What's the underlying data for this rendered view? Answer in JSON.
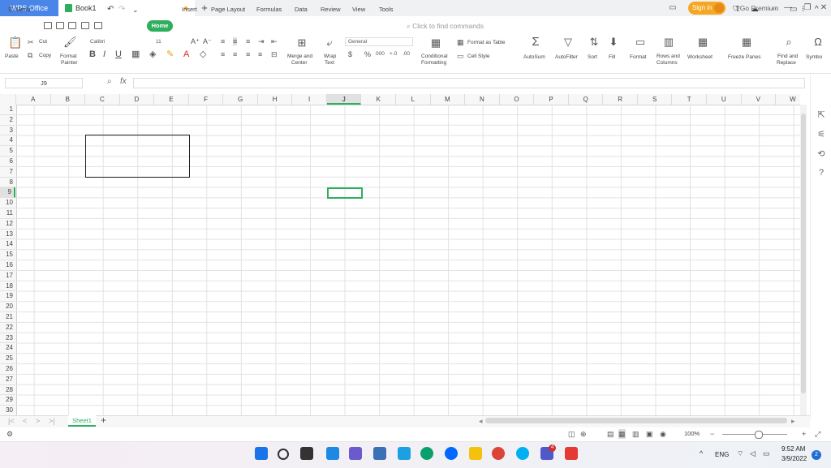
{
  "titlebar": {
    "app_tab": "WPS Office",
    "doc_tab": "Book1",
    "new_tab_icon": "plus-icon",
    "sign_in": "Sign in",
    "go_premium": "Go Premium"
  },
  "menu": {
    "menu_label": "Menu",
    "tabs": [
      "Home",
      "Insert",
      "Page Layout",
      "Formulas",
      "Data",
      "Review",
      "View",
      "Tools"
    ],
    "find_placeholder": "Click to find commands"
  },
  "ribbon": {
    "paste": "Paste",
    "cut": "Cut",
    "copy": "Copy",
    "format_painter_1": "Format",
    "format_painter_2": "Painter",
    "font_name": "Calibri",
    "font_size": "11",
    "bold": "B",
    "italic": "I",
    "underline": "U",
    "merge_1": "Merge and",
    "merge_2": "Center",
    "wrap_1": "Wrap",
    "wrap_2": "Text",
    "number_format": "General",
    "currency": "$",
    "percent": "%",
    "thousands": "000",
    "inc_decimal": "+.0",
    "dec_decimal": ".00",
    "cond_1": "Conditional",
    "cond_2": "Formatting",
    "format_as_table": "Format as Table",
    "cell_style": "Cell Style",
    "autosum": "AutoSum",
    "autofilter": "AutoFilter",
    "sort": "Sort",
    "fill": "Fill",
    "format": "Format",
    "rows_cols_1": "Rows and",
    "rows_cols_2": "Columns",
    "worksheet": "Worksheet",
    "freeze_panes": "Freeze Panes",
    "find_replace_1": "Find and",
    "find_replace_2": "Replace",
    "symbol": "Symbo"
  },
  "formula_bar": {
    "name_box": "J9",
    "fx": "fx",
    "value": ""
  },
  "grid": {
    "columns": [
      "A",
      "B",
      "C",
      "D",
      "E",
      "F",
      "G",
      "H",
      "I",
      "J",
      "K",
      "L",
      "M",
      "N",
      "O",
      "P",
      "Q",
      "R",
      "S",
      "T",
      "U",
      "V",
      "W"
    ],
    "rows": [
      "1",
      "2",
      "3",
      "4",
      "5",
      "6",
      "7",
      "8",
      "9",
      "10",
      "11",
      "12",
      "13",
      "14",
      "15",
      "16",
      "17",
      "18",
      "19",
      "20",
      "21",
      "22",
      "23",
      "24",
      "25",
      "26",
      "27",
      "28",
      "29",
      "30"
    ],
    "selected_column": "J",
    "selected_row": "9",
    "active_cell": "J9",
    "bordered_range": "C4:E7"
  },
  "sheets": {
    "tabs": [
      "Sheet1"
    ],
    "active": "Sheet1"
  },
  "status": {
    "zoom": "100%"
  },
  "taskbar": {
    "language": "ENG",
    "time": "9:52 AM",
    "date": "3/9/2022",
    "notifications": "2",
    "teams_badge": "4"
  },
  "colors": {
    "accent_green": "#2eae5e",
    "wps_blue": "#4a86e8",
    "sign_in_orange": "#f5a623"
  }
}
